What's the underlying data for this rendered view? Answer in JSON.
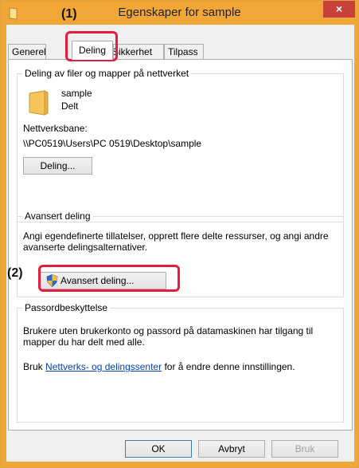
{
  "window": {
    "title": "Egenskaper for sample",
    "close_symbol": "×",
    "title_icon": "folder-icon",
    "accent_color": "#f0a737"
  },
  "tabs": [
    {
      "label": "Generelt",
      "active": false
    },
    {
      "label": "Deling",
      "active": true
    },
    {
      "label": "Sikkerhet",
      "active": false
    },
    {
      "label": "Tilpass",
      "active": false
    }
  ],
  "network_sharing": {
    "group_title": "Deling av filer og mapper på nettverket",
    "folder_name": "sample",
    "folder_status": "Delt",
    "path_label": "Nettverksbane:",
    "path_value": "\\\\PC0519\\Users\\PC 0519\\Desktop\\sample",
    "share_button": "Deling..."
  },
  "advanced_sharing": {
    "group_title": "Avansert deling",
    "description": "Angi egendefinerte tillatelser, opprett flere delte ressurser, og angi andre avanserte delingsalternativer.",
    "button": "Avansert deling..."
  },
  "password_protection": {
    "group_title": "Passordbeskyttelse",
    "description": "Brukere uten brukerkonto og passord på datamaskinen har tilgang til mapper du har delt med alle.",
    "text_before_link": "Bruk",
    "link": "Nettverks- og delingssenter",
    "text_after_link": "for å endre denne innstillingen."
  },
  "footer": {
    "ok": "OK",
    "cancel": "Avbryt",
    "apply": "Bruk"
  },
  "callouts": {
    "first": "(1)",
    "second": "(2)",
    "color": "#e41e3f"
  }
}
